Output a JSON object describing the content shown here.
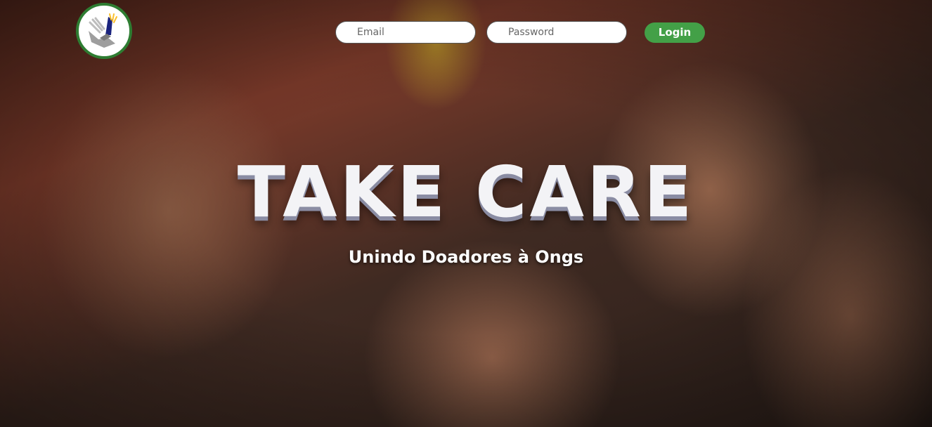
{
  "brand": {
    "name": "TAKE CARE",
    "tagline": "Unindo Doadores à Ongs"
  },
  "login": {
    "email_placeholder": "Email",
    "password_placeholder": "Password",
    "button_label": "Login"
  },
  "colors": {
    "accent": "#43a047",
    "logo_ring": "#2e7d32",
    "headline": "#f3f3f6"
  },
  "icons": {
    "logo": "helping-hands-logo-icon"
  }
}
